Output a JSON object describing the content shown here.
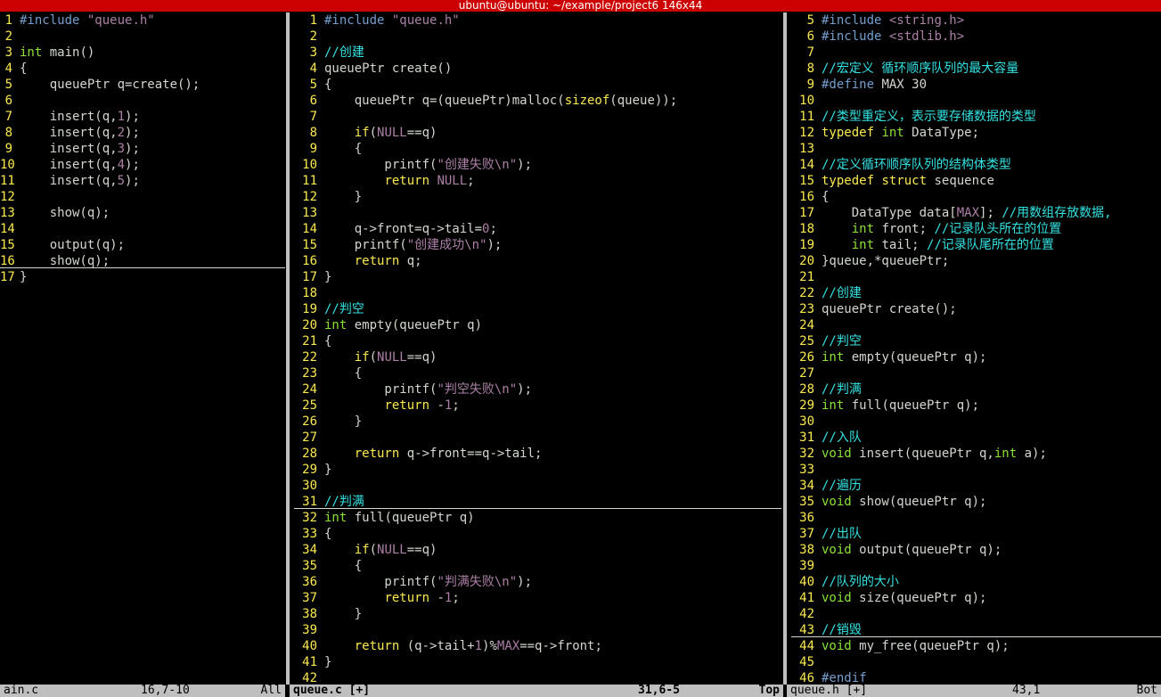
{
  "window": {
    "title": "ubuntu@ubuntu: ~/example/project6 146x44"
  },
  "panes": {
    "left": {
      "file": "main.c",
      "lines": [
        {
          "n": "1",
          "t": "#include \"queue.h\""
        },
        {
          "n": "2",
          "t": ""
        },
        {
          "n": "3",
          "t": "int main()"
        },
        {
          "n": "4",
          "t": "{"
        },
        {
          "n": "5",
          "t": "    queuePtr q=create();"
        },
        {
          "n": "6",
          "t": ""
        },
        {
          "n": "7",
          "t": "    insert(q,1);"
        },
        {
          "n": "8",
          "t": "    insert(q,2);"
        },
        {
          "n": "9",
          "t": "    insert(q,3);"
        },
        {
          "n": "10",
          "t": "    insert(q,4);"
        },
        {
          "n": "11",
          "t": "    insert(q,5);"
        },
        {
          "n": "12",
          "t": ""
        },
        {
          "n": "13",
          "t": "    show(q);"
        },
        {
          "n": "14",
          "t": ""
        },
        {
          "n": "15",
          "t": "    output(q);"
        },
        {
          "n": "16",
          "t": "    show(q);"
        },
        {
          "n": "17",
          "t": "}"
        }
      ],
      "status": {
        "name": "ain.c",
        "pos": "16,7-10",
        "pct": "All"
      }
    },
    "middle": {
      "file": "queue.c",
      "lines": [
        {
          "n": "1",
          "t": "#include \"queue.h\""
        },
        {
          "n": "2",
          "t": ""
        },
        {
          "n": "3",
          "t": "//创建"
        },
        {
          "n": "4",
          "t": "queuePtr create()"
        },
        {
          "n": "5",
          "t": "{"
        },
        {
          "n": "6",
          "t": "    queuePtr q=(queuePtr)malloc(sizeof(queue));"
        },
        {
          "n": "7",
          "t": ""
        },
        {
          "n": "8",
          "t": "    if(NULL==q)"
        },
        {
          "n": "9",
          "t": "    {"
        },
        {
          "n": "10",
          "t": "        printf(\"创建失败\\n\");"
        },
        {
          "n": "11",
          "t": "        return NULL;"
        },
        {
          "n": "12",
          "t": "    }"
        },
        {
          "n": "13",
          "t": ""
        },
        {
          "n": "14",
          "t": "    q->front=q->tail=0;"
        },
        {
          "n": "15",
          "t": "    printf(\"创建成功\\n\");"
        },
        {
          "n": "16",
          "t": "    return q;"
        },
        {
          "n": "17",
          "t": "}"
        },
        {
          "n": "18",
          "t": ""
        },
        {
          "n": "19",
          "t": "//判空"
        },
        {
          "n": "20",
          "t": "int empty(queuePtr q)"
        },
        {
          "n": "21",
          "t": "{"
        },
        {
          "n": "22",
          "t": "    if(NULL==q)"
        },
        {
          "n": "23",
          "t": "    {"
        },
        {
          "n": "24",
          "t": "        printf(\"判空失败\\n\");"
        },
        {
          "n": "25",
          "t": "        return -1;"
        },
        {
          "n": "26",
          "t": "    }"
        },
        {
          "n": "27",
          "t": ""
        },
        {
          "n": "28",
          "t": "    return q->front==q->tail;"
        },
        {
          "n": "29",
          "t": "}"
        },
        {
          "n": "30",
          "t": ""
        },
        {
          "n": "31",
          "t": "//判满"
        },
        {
          "n": "32",
          "t": "int full(queuePtr q)"
        },
        {
          "n": "33",
          "t": "{"
        },
        {
          "n": "34",
          "t": "    if(NULL==q)"
        },
        {
          "n": "35",
          "t": "    {"
        },
        {
          "n": "36",
          "t": "        printf(\"判满失败\\n\");"
        },
        {
          "n": "37",
          "t": "        return -1;"
        },
        {
          "n": "38",
          "t": "    }"
        },
        {
          "n": "39",
          "t": ""
        },
        {
          "n": "40",
          "t": "    return (q->tail+1)%MAX==q->front;"
        },
        {
          "n": "41",
          "t": "}"
        },
        {
          "n": "42",
          "t": ""
        }
      ],
      "status": {
        "name": "queue.c [+]",
        "pos": "31,6-5",
        "pct": "Top"
      }
    },
    "right": {
      "file": "queue.h",
      "lines": [
        {
          "n": "5",
          "t": "#include <string.h>"
        },
        {
          "n": "6",
          "t": "#include <stdlib.h>"
        },
        {
          "n": "7",
          "t": ""
        },
        {
          "n": "8",
          "t": "//宏定义 循环顺序队列的最大容量"
        },
        {
          "n": "9",
          "t": "#define MAX 30"
        },
        {
          "n": "10",
          "t": ""
        },
        {
          "n": "11",
          "t": "//类型重定义，表示要存储数据的类型"
        },
        {
          "n": "12",
          "t": "typedef int DataType;"
        },
        {
          "n": "13",
          "t": ""
        },
        {
          "n": "14",
          "t": "//定义循环顺序队列的结构体类型"
        },
        {
          "n": "15",
          "t": "typedef struct sequence"
        },
        {
          "n": "16",
          "t": "{"
        },
        {
          "n": "17",
          "t": "    DataType data[MAX]; //用数组存放数据,"
        },
        {
          "n": "18",
          "t": "    int front; //记录队头所在的位置"
        },
        {
          "n": "19",
          "t": "    int tail; //记录队尾所在的位置"
        },
        {
          "n": "20",
          "t": "}queue,*queuePtr;"
        },
        {
          "n": "21",
          "t": ""
        },
        {
          "n": "22",
          "t": "//创建"
        },
        {
          "n": "23",
          "t": "queuePtr create();"
        },
        {
          "n": "24",
          "t": ""
        },
        {
          "n": "25",
          "t": "//判空"
        },
        {
          "n": "26",
          "t": "int empty(queuePtr q);"
        },
        {
          "n": "27",
          "t": ""
        },
        {
          "n": "28",
          "t": "//判满"
        },
        {
          "n": "29",
          "t": "int full(queuePtr q);"
        },
        {
          "n": "30",
          "t": ""
        },
        {
          "n": "31",
          "t": "//入队"
        },
        {
          "n": "32",
          "t": "void insert(queuePtr q,int a);"
        },
        {
          "n": "33",
          "t": ""
        },
        {
          "n": "34",
          "t": "//遍历"
        },
        {
          "n": "35",
          "t": "void show(queuePtr q);"
        },
        {
          "n": "36",
          "t": ""
        },
        {
          "n": "37",
          "t": "//出队"
        },
        {
          "n": "38",
          "t": "void output(queuePtr q);"
        },
        {
          "n": "39",
          "t": ""
        },
        {
          "n": "40",
          "t": "//队列的大小"
        },
        {
          "n": "41",
          "t": "void size(queuePtr q);"
        },
        {
          "n": "42",
          "t": ""
        },
        {
          "n": "43",
          "t": "//销毁"
        },
        {
          "n": "44",
          "t": "void my_free(queuePtr q);"
        },
        {
          "n": "45",
          "t": ""
        },
        {
          "n": "46",
          "t": "#endif"
        }
      ],
      "status": {
        "name": "queue.h [+]",
        "pos": "43,1",
        "pct": "Bot"
      }
    }
  },
  "colors": {
    "keyword": "#fce94f",
    "preproc": "#729fcf",
    "comment": "#34e2e2",
    "string": "#ad7fa8",
    "type": "#8ae234",
    "linenr": "#fce94f",
    "text": "#d3d7cf",
    "titlebar": "#cc0000",
    "statusbar": "#bfbfbf"
  }
}
